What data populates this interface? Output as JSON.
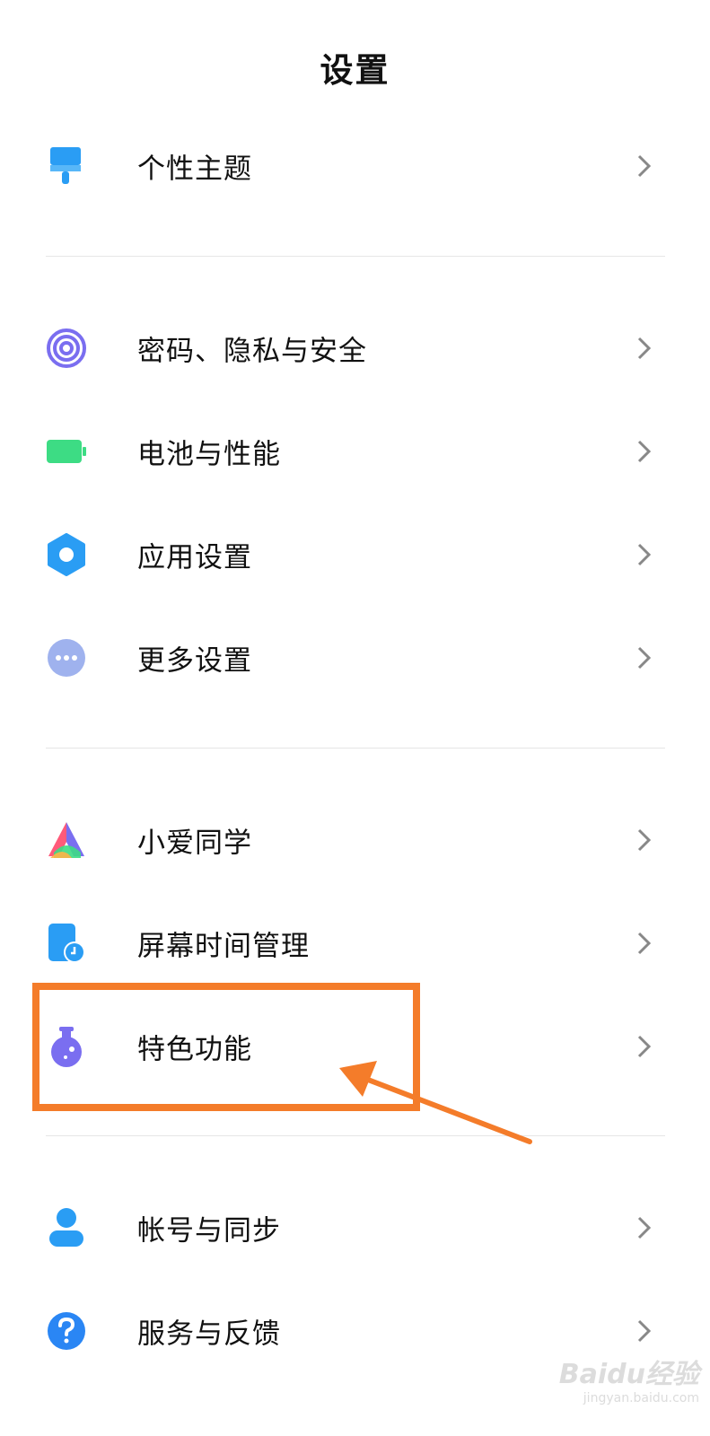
{
  "header": {
    "title": "设置"
  },
  "groups": [
    {
      "items": [
        {
          "label": "个性主题",
          "icon": "paint-brush-icon"
        }
      ]
    },
    {
      "items": [
        {
          "label": "密码、隐私与安全",
          "icon": "fingerprint-icon"
        },
        {
          "label": "电池与性能",
          "icon": "battery-icon"
        },
        {
          "label": "应用设置",
          "icon": "gear-icon"
        },
        {
          "label": "更多设置",
          "icon": "more-dots-icon"
        }
      ]
    },
    {
      "items": [
        {
          "label": "小爱同学",
          "icon": "xiaoai-icon"
        },
        {
          "label": "屏幕时间管理",
          "icon": "screen-time-icon"
        },
        {
          "label": "特色功能",
          "icon": "flask-icon"
        }
      ]
    },
    {
      "items": [
        {
          "label": "帐号与同步",
          "icon": "user-icon"
        },
        {
          "label": "服务与反馈",
          "icon": "help-icon"
        }
      ]
    }
  ],
  "annotation": {
    "highlighted_item": "特色功能",
    "color": "#f47c2a"
  },
  "watermark": {
    "main": "Baidu经验",
    "sub": "jingyan.baidu.com"
  }
}
